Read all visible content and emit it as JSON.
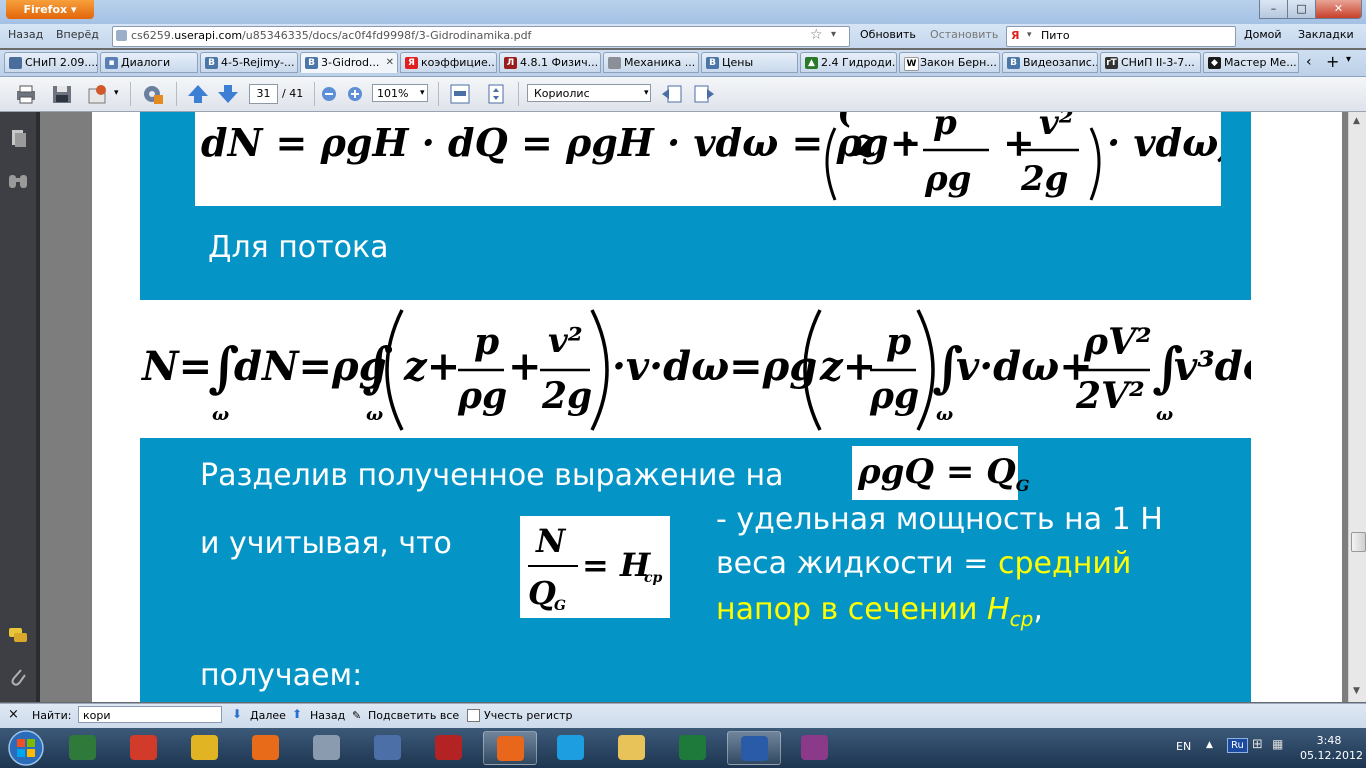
{
  "browser": {
    "menu_label": "Firefox",
    "back": "Назад",
    "forward": "Вперёд",
    "url_prefix": "cs6259.",
    "url_domain": "userapi.com",
    "url_path": "/u85346335/docs/ac0f4fd9998f/3-Gidrodinamika.pdf",
    "refresh": "Обновить",
    "stop": "Остановить",
    "search_value": "Пито",
    "home": "Домой",
    "bookmarks": "Закладки",
    "window_buttons": [
      "–",
      "□",
      "✕"
    ]
  },
  "tabs": [
    {
      "label": "СНиП 2.09....",
      "color": "#4a6d9c",
      "glyph": ""
    },
    {
      "label": "Диалоги",
      "color": "#5a7fb5",
      "glyph": "▪"
    },
    {
      "label": "4-5-Rejimy-...",
      "color": "#4a76a8",
      "glyph": "B"
    },
    {
      "label": "3-Gidrod...",
      "color": "#4a76a8",
      "glyph": "B"
    },
    {
      "label": "коэффицие...",
      "color": "#e02020",
      "glyph": "Я"
    },
    {
      "label": "4.8.1 Физич...",
      "color": "#9a1d1d",
      "glyph": "Л"
    },
    {
      "label": "Механика ...",
      "color": "#8a8f98",
      "glyph": ""
    },
    {
      "label": "Цены",
      "color": "#4a76a8",
      "glyph": "B"
    },
    {
      "label": "2.4 Гидроди...",
      "color": "#2a7a2a",
      "glyph": "▲"
    },
    {
      "label": "Закон Берн...",
      "color": "#ffffff",
      "glyph": "W"
    },
    {
      "label": "Видеозапис...",
      "color": "#4a76a8",
      "glyph": "B"
    },
    {
      "label": "СНиП II-3-7...",
      "color": "#333333",
      "glyph": "rT"
    },
    {
      "label": "Мастер Ме...",
      "color": "#1a1a1a",
      "glyph": "◆"
    }
  ],
  "pdf_toolbar": {
    "page": "31",
    "page_total": "/ 41",
    "zoom": "101%",
    "search_value": "Кориолис"
  },
  "slide": {
    "formula1": "dN = ρgH · dQ = ρgH · vdω = ρg · ( z + p/ρg + v²/2g ) · vdω;",
    "flow_label": "Для потока",
    "divide_text": "Разделив полученное выражение на",
    "formula_rhoGQ": "ρgQ = Q",
    "formula_rhoGQ_sub": "G",
    "considering_text": "и учитывая, что",
    "note_line1": "- удельная мощность на 1 Н",
    "note_line2a": "веса жидкости  = ",
    "note_line2b": "средний",
    "note_line3a": "напор в сечении ",
    "note_line3b": "H",
    "note_line3c": "ср",
    "note_line3d": ",",
    "getting_text": "получаем:"
  },
  "findbar": {
    "label": "Найти:",
    "value": "кори",
    "next": "Далее",
    "prev": "Назад",
    "highlight": "Подсветить все",
    "match_case": "Учесть регистр"
  },
  "tray": {
    "lang": "EN",
    "kbd": "Ru",
    "time": "3:48",
    "date": "05.12.2012"
  },
  "colors": {
    "slide_blue": "#0594c6",
    "highlight_yellow": "#ffff00"
  }
}
